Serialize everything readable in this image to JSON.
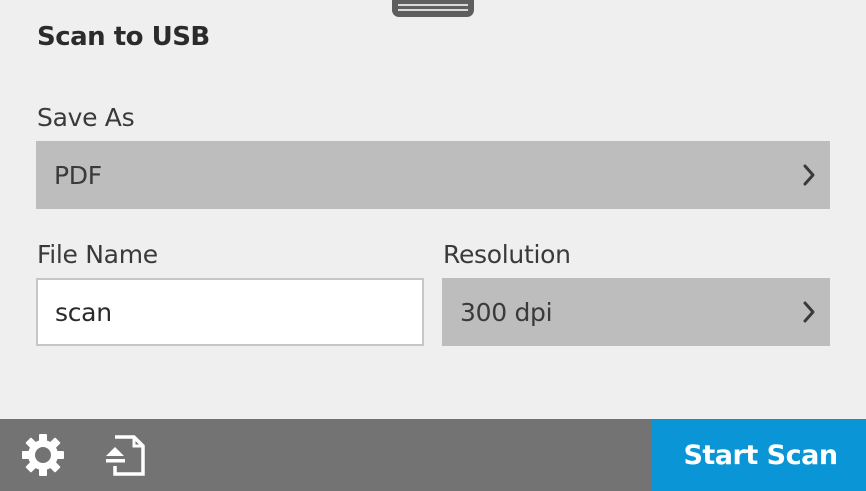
{
  "header": {
    "title": "Scan to USB"
  },
  "fields": {
    "save_as": {
      "label": "Save As",
      "value": "PDF"
    },
    "file_name": {
      "label": "File Name",
      "value": "scan"
    },
    "resolution": {
      "label": "Resolution",
      "value": "300 dpi"
    }
  },
  "toolbar": {
    "settings_icon": "gear-icon",
    "scan_source_icon": "document-feeder-icon",
    "start_label": "Start Scan"
  },
  "colors": {
    "background": "#efefef",
    "select_fill": "#bdbdbd",
    "bottom_bar": "#737373",
    "accent": "#0a96d6"
  }
}
